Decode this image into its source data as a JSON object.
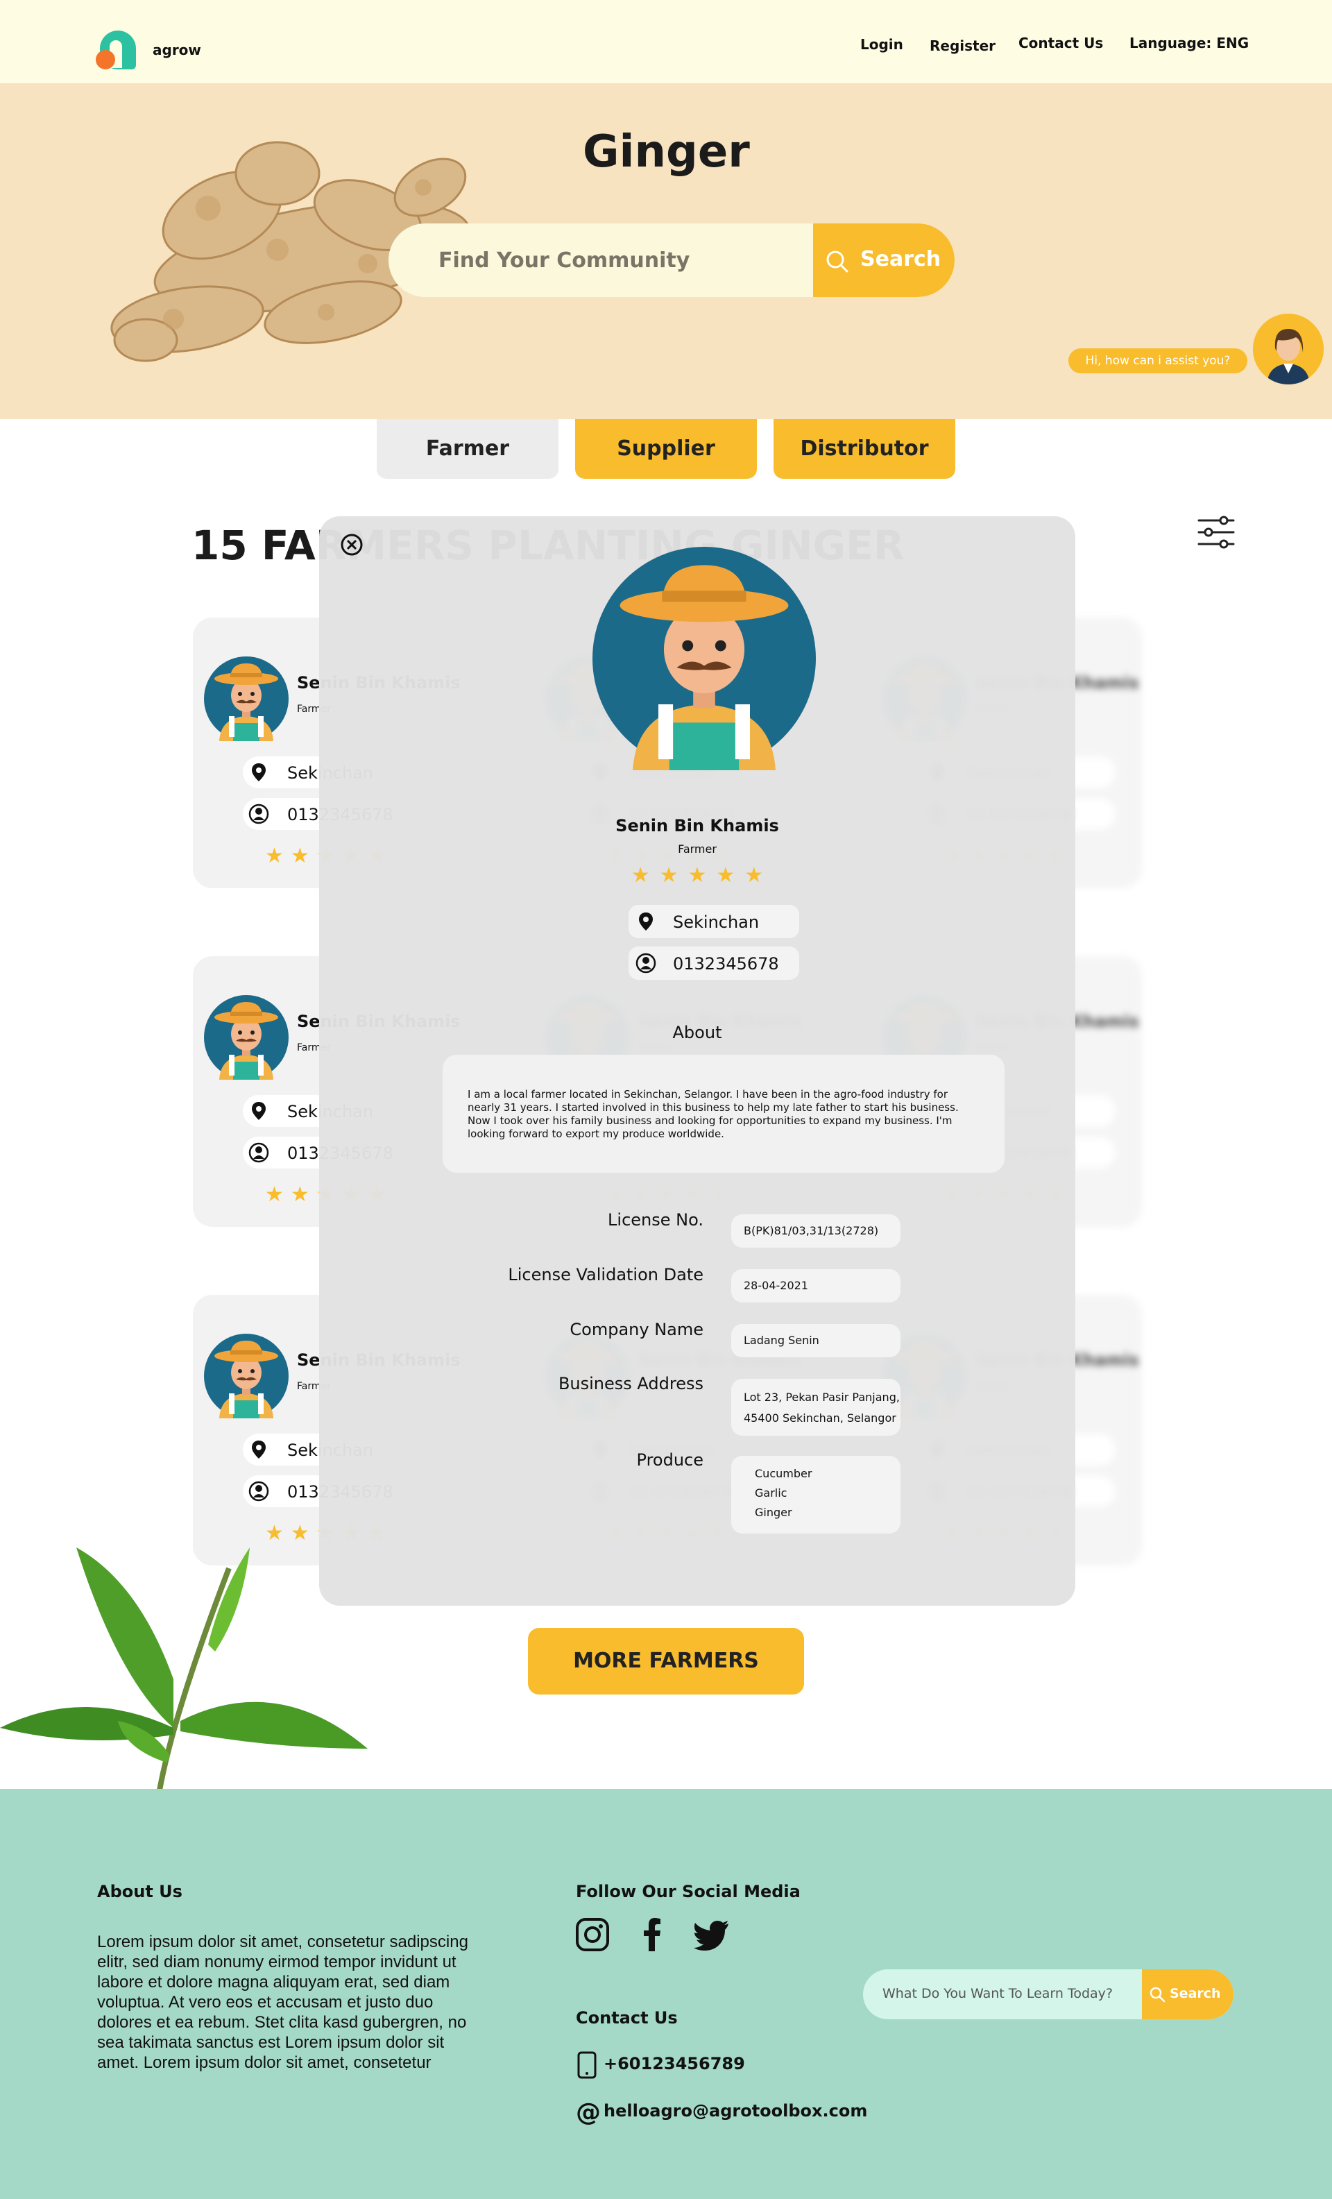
{
  "nav": {
    "brand": "agrow",
    "links": [
      "Login",
      "Register",
      "Contact Us",
      "Language: ENG"
    ]
  },
  "hero": {
    "title": "Ginger",
    "search_placeholder": "Find Your Community",
    "search_button": "Search",
    "assistant_bubble": "Hi, how can i assist you?"
  },
  "tabs": [
    {
      "label": "Farmer",
      "active": true
    },
    {
      "label": "Supplier",
      "active": false
    },
    {
      "label": "Distributor",
      "active": false
    }
  ],
  "list": {
    "heading": "15 FARMERS PLANTING GINGER",
    "cards": [
      {
        "name": "Senin Bin Khamis",
        "role": "Farmer",
        "location": "Sekinchan",
        "phone": "0132345678",
        "rating": 5
      },
      {
        "name": "Senin Bin Khamis",
        "role": "Farmer",
        "location": "Sekinchan",
        "phone": "0132345678",
        "rating": 5
      },
      {
        "name": "Senin Bin Khamis",
        "role": "Farmer",
        "location": "Sekinchan",
        "phone": "0132345678",
        "rating": 5
      },
      {
        "name": "Senin Bin Khamis",
        "role": "Farmer",
        "location": "Sekinchan",
        "phone": "0132345678",
        "rating": 5
      },
      {
        "name": "Senin Bin Khamis",
        "role": "Farmer",
        "location": "Sekinchan",
        "phone": "0132345678",
        "rating": 5
      },
      {
        "name": "Senin Bin Khamis",
        "role": "Farmer",
        "location": "Sekinchan",
        "phone": "0132345678",
        "rating": 5
      },
      {
        "name": "Senin Bin Khamis",
        "role": "Farmer",
        "location": "Sekinchan",
        "phone": "0132345678",
        "rating": 5
      },
      {
        "name": "Senin Bin Khamis",
        "role": "Farmer",
        "location": "Sekinchan",
        "phone": "0132345678",
        "rating": 5
      },
      {
        "name": "Senin Bin Khamis",
        "role": "Farmer",
        "location": "Sekinchan",
        "phone": "0132345678",
        "rating": 5
      }
    ],
    "more_button": "MORE FARMERS"
  },
  "modal": {
    "name": "Senin Bin Khamis",
    "role": "Farmer",
    "stars": "★★★★★",
    "location": "Sekinchan",
    "phone": "0132345678",
    "about_heading": "About",
    "about_text": "I am a local farmer located in Sekinchan, Selangor. I have been in the agro-food industry for nearly 31 years. I started involved in this business to help my late father to start his business. Now I took over his family business and looking for opportunities to expand my business. I'm looking forward to export my produce worldwide.",
    "fields": {
      "license_no_label": "License No.",
      "license_no": "B(PK)81/03,31/13(2728)",
      "license_date_label": "License Validation Date",
      "license_date": "28-04-2021",
      "company_label": "Company Name",
      "company": "Ladang Senin",
      "address_label": "Business Address",
      "address_line1": "Lot 23, Pekan Pasir Panjang,",
      "address_line2": "45400 Sekinchan, Selangor",
      "produce_label": "Produce",
      "produce": [
        "Cucumber",
        "Garlic",
        "Ginger"
      ]
    }
  },
  "footer": {
    "about_heading": "About Us",
    "about_text": "Lorem ipsum dolor sit amet, consetetur sadipscing elitr, sed diam nonumy eirmod tempor invidunt ut labore et dolore magna aliquyam erat, sed diam voluptua. At vero eos et accusam et justo duo dolores et ea rebum. Stet clita kasd gubergren, no sea takimata sanctus est Lorem ipsum dolor sit amet. Lorem ipsum dolor sit amet, consetetur",
    "social_heading": "Follow Our Social Media",
    "contact_heading": "Contact Us",
    "phone": "+60123456789",
    "email": "helloagro@agrotoolbox.com",
    "search_placeholder": "What Do You Want To Learn Today?",
    "search_button": "Search"
  },
  "colors": {
    "accent": "#f8bc2c",
    "nav_bg": "#fefde4",
    "hero_bg": "#f7e3bf",
    "footer_bg": "#a5d9c7",
    "brand_teal": "#2cc1a0",
    "brand_orange": "#f4742a"
  }
}
